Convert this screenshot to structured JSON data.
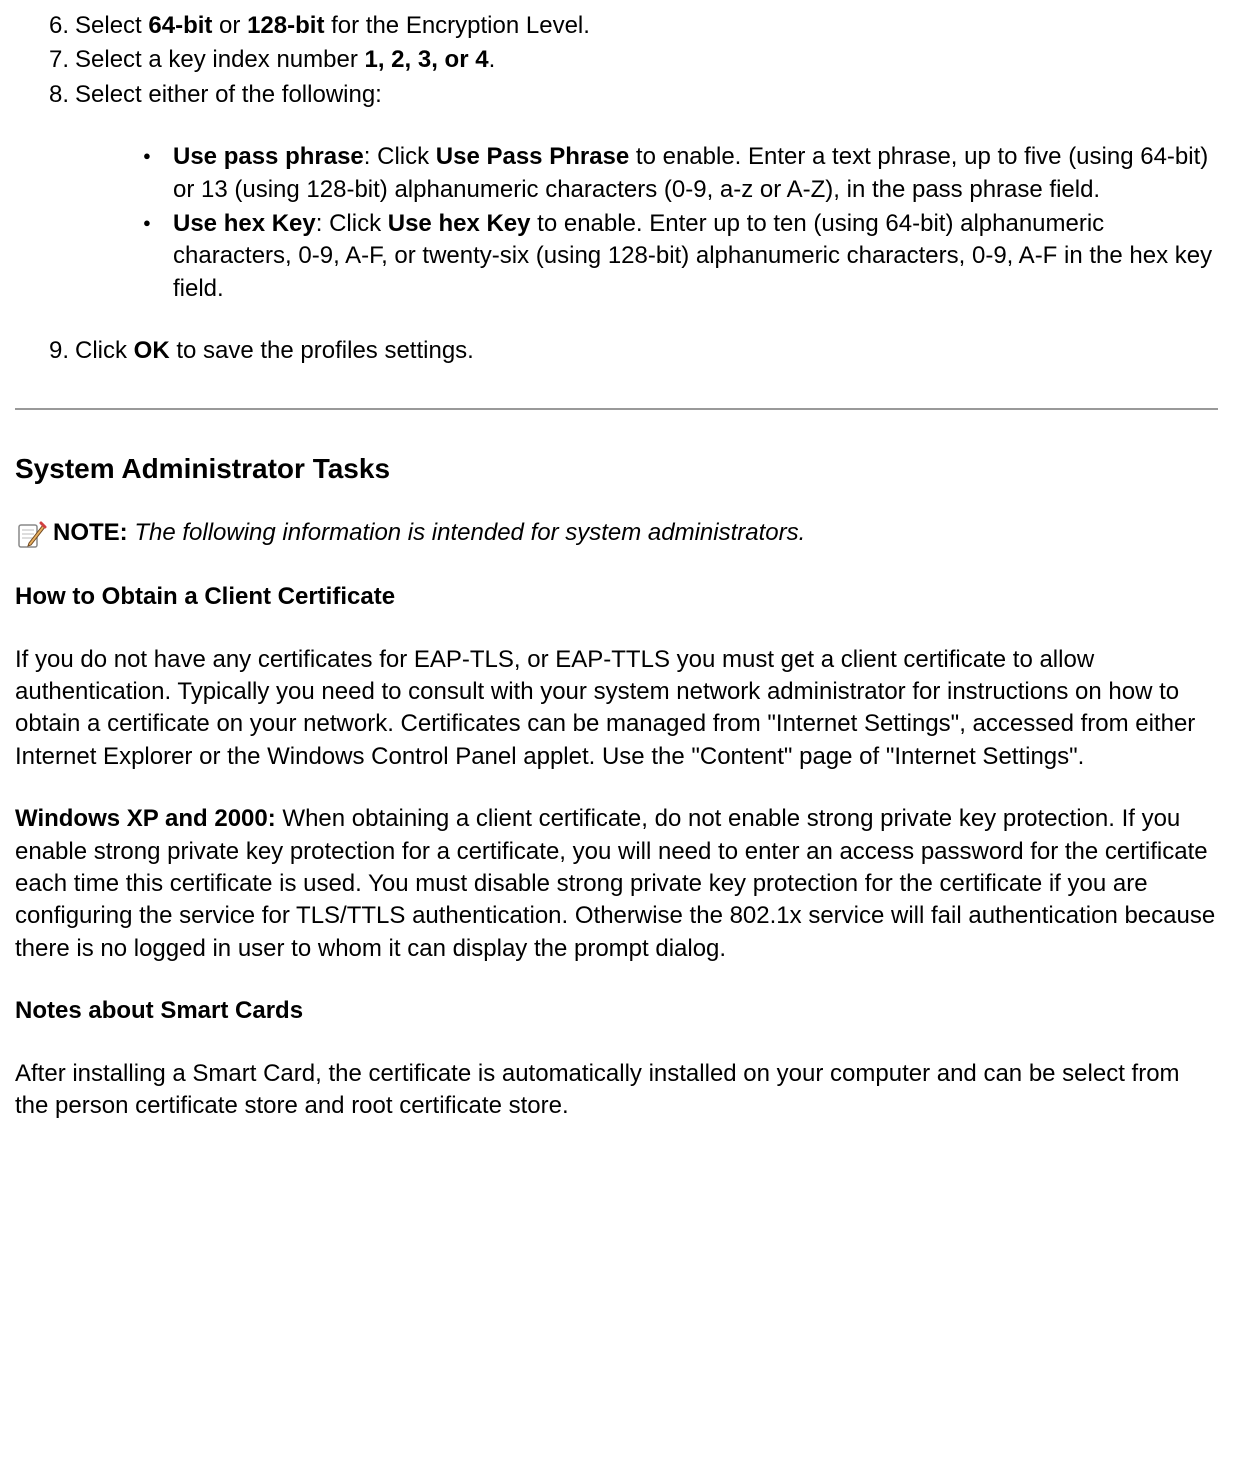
{
  "list": {
    "item6": {
      "num": "6.",
      "prefix": "Select ",
      "bold1": "64-bit",
      "mid": " or ",
      "bold2": "128-bit",
      "suffix": " for the Encryption Level."
    },
    "item7": {
      "num": "7.",
      "prefix": "Select a key index number ",
      "bold1": "1, 2, 3, or 4",
      "suffix": "."
    },
    "item8": {
      "num": "8.",
      "text": "Select either of the following:"
    },
    "bullet1": {
      "bold1": "Use pass phrase",
      "mid1": ": Click ",
      "bold2": "Use Pass Phrase",
      "suffix": " to enable. Enter a text phrase, up to five (using 64-bit) or 13 (using 128-bit) alphanumeric characters (0-9, a-z or A-Z), in the pass phrase field."
    },
    "bullet2": {
      "bold1": "Use hex Key",
      "mid1": ": Click ",
      "bold2": "Use hex Key",
      "suffix": " to enable. Enter up to ten (using 64-bit) alphanumeric characters, 0-9, A-F, or twenty-six (using 128-bit) alphanumeric characters, 0-9, A-F in the hex key field."
    },
    "item9": {
      "num": "9.",
      "prefix": "Click ",
      "bold1": "OK",
      "suffix": " to save the profiles settings."
    }
  },
  "section": {
    "heading": "System Administrator Tasks",
    "noteLabel": "NOTE:",
    "noteText": " The following information is intended for system administrators.",
    "sub1": "How to Obtain a Client Certificate",
    "para1": "If you do not have any certificates for EAP-TLS, or EAP-TTLS you must get a client certificate to allow authentication. Typically you need to consult with your system network administrator for instructions on how to obtain a certificate on your network. Certificates can be managed from \"Internet Settings\", accessed from either Internet Explorer or the Windows Control Panel applet. Use the \"Content\" page of \"Internet Settings\".",
    "para2_bold": "Windows XP and 2000:",
    "para2": " When obtaining a client certificate, do not enable strong private key protection. If you enable strong private key protection for a certificate, you will need to enter an access password for the certificate each time this certificate is used. You must disable strong private key protection for the certificate if you are configuring the service for TLS/TTLS authentication. Otherwise the 802.1x service will fail authentication because there is no logged in user to whom it can display the prompt dialog.",
    "sub2": "Notes about Smart Cards",
    "para3": "After installing a Smart Card, the certificate is automatically installed on your computer and can be select from the person certificate store and root certificate store."
  }
}
